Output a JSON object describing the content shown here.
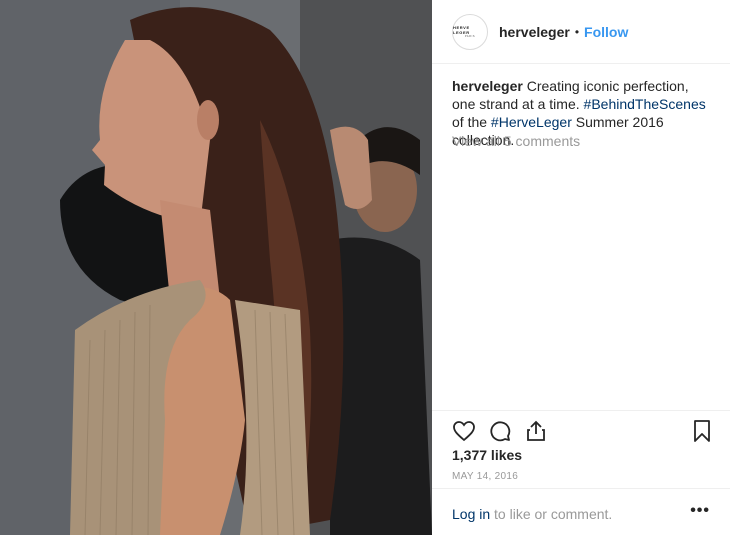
{
  "post": {
    "username": "herveleger",
    "follow_label": "Follow",
    "separator": "•",
    "avatar": {
      "brand": "HERVE LEGER",
      "sub": "PARIS"
    },
    "caption": {
      "user": "herveleger",
      "text_1": " Creating iconic perfection, one strand at a time. ",
      "tag_1": "#BehindTheScenes",
      "text_2": " of the ",
      "tag_2": "#HerveLeger",
      "text_3": " Summer 2016 collection."
    },
    "comments_label": "View all 5 comments",
    "likes": "1,377 likes",
    "date": "MAY 14, 2016",
    "login": {
      "link": "Log in",
      "rest": " to like or comment."
    },
    "more_label": "•••"
  },
  "icons": {
    "like": "heart-icon",
    "comment": "comment-icon",
    "share": "share-icon",
    "save": "bookmark-icon",
    "more": "more-options-icon"
  },
  "colors": {
    "accent": "#3897f0",
    "hashtag": "#003569",
    "muted": "#999999",
    "text": "#262626"
  }
}
